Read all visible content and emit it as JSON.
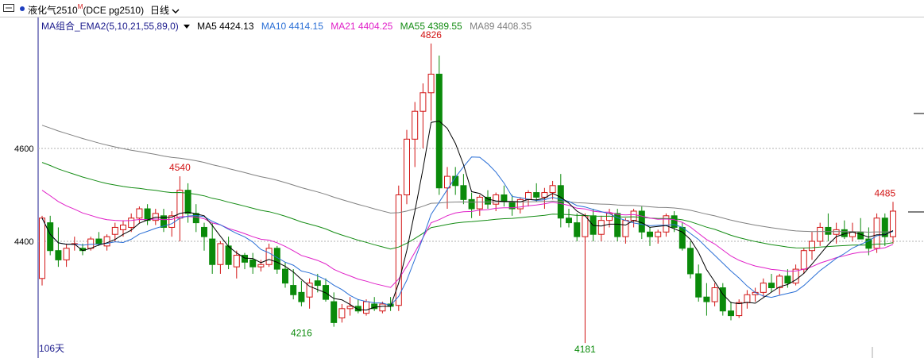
{
  "toolbar": {
    "menu_icon": "panel-toggle-icon",
    "symbol": "液化气2510",
    "symbol_tag": "M",
    "symbol_code": "(DCE pg2510)",
    "period": "日线"
  },
  "legend": {
    "selector": "MA组合_EMA2(5,10,21,55,89,0)",
    "items": [
      {
        "label": "MA5 4424.13",
        "color": "#000000"
      },
      {
        "label": "MA10 4414.15",
        "color": "#2a6fd6"
      },
      {
        "label": "MA21 4404.25",
        "color": "#e020c8"
      },
      {
        "label": "MA55 4389.55",
        "color": "#148c14"
      },
      {
        "label": "MA89 4408.35",
        "color": "#808080"
      }
    ]
  },
  "colors": {
    "up": "#d21414",
    "down": "#0a8a0a",
    "grid": "#b0b0b0",
    "axis": "#1a1a8c"
  },
  "chart_data": {
    "type": "candlestick",
    "ylim": [
      4180,
      4830
    ],
    "y_ticks": [
      4400,
      4600
    ],
    "y_tick_labels": [
      "4400",
      "4600"
    ],
    "grid": "dashed horizontal at y ticks",
    "bar_count_label": "106天",
    "annotations": [
      {
        "text": "4826",
        "index": 48,
        "value": 4826,
        "kind": "high"
      },
      {
        "text": "4540",
        "index": 17,
        "value": 4540,
        "kind": "high"
      },
      {
        "text": "4216",
        "index": 32,
        "value": 4216,
        "kind": "low"
      },
      {
        "text": "4181",
        "index": 67,
        "value": 4181,
        "kind": "low"
      },
      {
        "text": "4485",
        "index": 104,
        "value": 4485,
        "kind": "high"
      }
    ],
    "ohlc": [
      [
        4320,
        4455,
        4305,
        4450
      ],
      [
        4440,
        4455,
        4370,
        4380
      ],
      [
        4380,
        4430,
        4345,
        4360
      ],
      [
        4360,
        4395,
        4345,
        4385
      ],
      [
        4395,
        4410,
        4380,
        4395
      ],
      [
        4385,
        4395,
        4370,
        4380
      ],
      [
        4385,
        4410,
        4380,
        4405
      ],
      [
        4405,
        4420,
        4390,
        4395
      ],
      [
        4390,
        4415,
        4380,
        4410
      ],
      [
        4415,
        4440,
        4400,
        4430
      ],
      [
        4425,
        4445,
        4410,
        4435
      ],
      [
        4430,
        4460,
        4420,
        4450
      ],
      [
        4450,
        4475,
        4440,
        4470
      ],
      [
        4470,
        4480,
        4435,
        4445
      ],
      [
        4445,
        4470,
        4435,
        4460
      ],
      [
        4455,
        4470,
        4420,
        4430
      ],
      [
        4430,
        4465,
        4410,
        4455
      ],
      [
        4450,
        4540,
        4400,
        4510
      ],
      [
        4510,
        4525,
        4440,
        4460
      ],
      [
        4460,
        4480,
        4420,
        4440
      ],
      [
        4430,
        4440,
        4380,
        4410
      ],
      [
        4405,
        4440,
        4330,
        4350
      ],
      [
        4350,
        4400,
        4330,
        4395
      ],
      [
        4390,
        4410,
        4340,
        4350
      ],
      [
        4345,
        4380,
        4320,
        4370
      ],
      [
        4370,
        4375,
        4340,
        4355
      ],
      [
        4360,
        4375,
        4330,
        4345
      ],
      [
        4345,
        4360,
        4335,
        4350
      ],
      [
        4350,
        4395,
        4345,
        4385
      ],
      [
        4385,
        4390,
        4330,
        4340
      ],
      [
        4340,
        4355,
        4300,
        4310
      ],
      [
        4305,
        4340,
        4275,
        4285
      ],
      [
        4290,
        4315,
        4260,
        4270
      ],
      [
        4280,
        4320,
        4255,
        4310
      ],
      [
        4315,
        4330,
        4290,
        4305
      ],
      [
        4305,
        4320,
        4270,
        4275
      ],
      [
        4270,
        4290,
        4216,
        4225
      ],
      [
        4235,
        4265,
        4225,
        4255
      ],
      [
        4255,
        4280,
        4240,
        4260
      ],
      [
        4260,
        4275,
        4245,
        4250
      ],
      [
        4245,
        4275,
        4240,
        4270
      ],
      [
        4265,
        4280,
        4250,
        4255
      ],
      [
        4250,
        4270,
        4245,
        4265
      ],
      [
        4265,
        4280,
        4250,
        4260
      ],
      [
        4262,
        4520,
        4250,
        4500
      ],
      [
        4500,
        4640,
        4480,
        4620
      ],
      [
        4620,
        4700,
        4560,
        4680
      ],
      [
        4680,
        4740,
        4600,
        4720
      ],
      [
        4720,
        4826,
        4660,
        4760
      ],
      [
        4760,
        4800,
        4500,
        4515
      ],
      [
        4515,
        4560,
        4470,
        4540
      ],
      [
        4540,
        4560,
        4500,
        4520
      ],
      [
        4520,
        4545,
        4480,
        4490
      ],
      [
        4490,
        4505,
        4450,
        4470
      ],
      [
        4470,
        4500,
        4455,
        4495
      ],
      [
        4495,
        4510,
        4470,
        4480
      ],
      [
        4480,
        4505,
        4465,
        4500
      ],
      [
        4500,
        4520,
        4475,
        4485
      ],
      [
        4485,
        4500,
        4455,
        4470
      ],
      [
        4470,
        4495,
        4460,
        4490
      ],
      [
        4490,
        4510,
        4475,
        4505
      ],
      [
        4505,
        4525,
        4485,
        4495
      ],
      [
        4495,
        4515,
        4470,
        4505
      ],
      [
        4505,
        4530,
        4490,
        4520
      ],
      [
        4520,
        4545,
        4430,
        4450
      ],
      [
        4450,
        4470,
        4430,
        4440
      ],
      [
        4440,
        4460,
        4400,
        4410
      ],
      [
        4410,
        4460,
        4181,
        4455
      ],
      [
        4455,
        4470,
        4400,
        4415
      ],
      [
        4415,
        4455,
        4400,
        4445
      ],
      [
        4445,
        4470,
        4430,
        4460
      ],
      [
        4460,
        4470,
        4400,
        4410
      ],
      [
        4410,
        4450,
        4395,
        4445
      ],
      [
        4445,
        4470,
        4430,
        4465
      ],
      [
        4465,
        4475,
        4405,
        4420
      ],
      [
        4420,
        4430,
        4390,
        4410
      ],
      [
        4410,
        4425,
        4395,
        4420
      ],
      [
        4420,
        4460,
        4410,
        4455
      ],
      [
        4455,
        4465,
        4420,
        4430
      ],
      [
        4430,
        4440,
        4380,
        4385
      ],
      [
        4385,
        4400,
        4320,
        4330
      ],
      [
        4330,
        4350,
        4270,
        4280
      ],
      [
        4280,
        4310,
        4240,
        4270
      ],
      [
        4270,
        4310,
        4260,
        4300
      ],
      [
        4300,
        4310,
        4240,
        4250
      ],
      [
        4250,
        4270,
        4230,
        4240
      ],
      [
        4240,
        4275,
        4235,
        4268
      ],
      [
        4268,
        4295,
        4255,
        4285
      ],
      [
        4285,
        4300,
        4270,
        4290
      ],
      [
        4290,
        4320,
        4280,
        4310
      ],
      [
        4310,
        4330,
        4290,
        4300
      ],
      [
        4300,
        4330,
        4285,
        4325
      ],
      [
        4325,
        4340,
        4300,
        4310
      ],
      [
        4310,
        4350,
        4305,
        4340
      ],
      [
        4340,
        4385,
        4330,
        4380
      ],
      [
        4380,
        4420,
        4360,
        4400
      ],
      [
        4400,
        4440,
        4390,
        4430
      ],
      [
        4430,
        4460,
        4400,
        4415
      ],
      [
        4415,
        4440,
        4395,
        4425
      ],
      [
        4425,
        4445,
        4405,
        4410
      ],
      [
        4410,
        4440,
        4400,
        4420
      ],
      [
        4420,
        4450,
        4410,
        4405
      ],
      [
        4405,
        4430,
        4370,
        4385
      ],
      [
        4385,
        4460,
        4375,
        4450
      ],
      [
        4450,
        4460,
        4390,
        4410
      ],
      [
        4410,
        4485,
        4395,
        4465
      ]
    ]
  }
}
